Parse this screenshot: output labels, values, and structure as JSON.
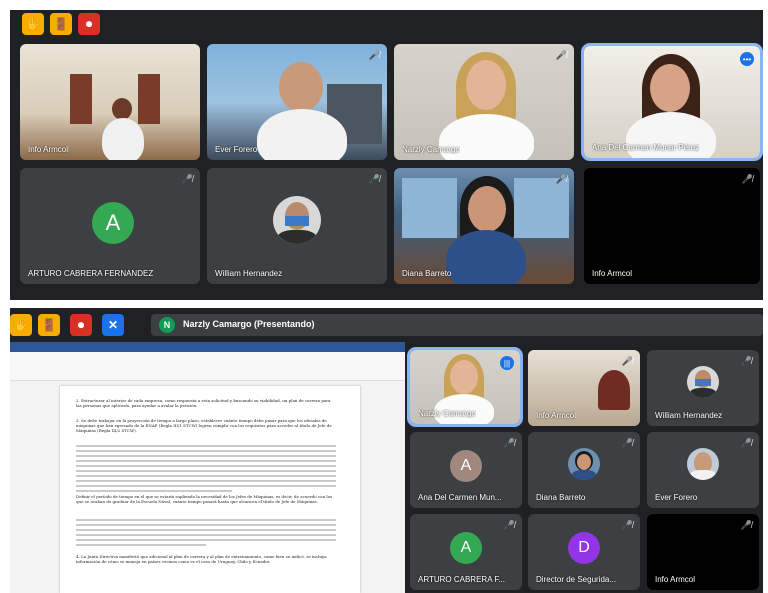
{
  "meeting1": {
    "tiles": [
      {
        "name": "Info Armcol"
      },
      {
        "name": "Ever Forero"
      },
      {
        "name": "Narzly Camargo"
      },
      {
        "name": "Ana Del Carmen Munar Pérez"
      },
      {
        "name": "ARTURO CABRERA FERNANDEZ",
        "initial": "A"
      },
      {
        "name": "William Hernandez"
      },
      {
        "name": "Diana Barreto"
      },
      {
        "name": "Info Armcol"
      }
    ]
  },
  "meeting2": {
    "presenter_initial": "N",
    "presenting_label": "Narzly Camargo (Presentando)",
    "tiles": [
      {
        "name": "Narzly Camargo"
      },
      {
        "name": "Info Armcol"
      },
      {
        "name": "William Hernandez"
      },
      {
        "name": "Ana Del Carmen Mun...",
        "initial": "A"
      },
      {
        "name": "Diana Barreto"
      },
      {
        "name": "Ever Forero"
      },
      {
        "name": "ARTURO CABRERA F...",
        "initial": "A"
      },
      {
        "name": "Director de Segurida...",
        "initial": "D"
      },
      {
        "name": "Info Armcol"
      }
    ]
  },
  "document": {
    "p1": "2.   Estructurar al interior de cada empresa, como respuesta a esta solicitud y buscando su viabilidad, un plan de carrera para las personas que aplicaría, para ayudar a avalar la petición.",
    "p2": "3.   Se debe trabajar en la proyección de tiempo a largo plazo, establecer cuánto tiempo debe pasar para que los oficiales de máquinas que han egresado de la ENAP (Regla III/1 STCW) logren cumplir con los requisitos para acceder al título de Jefe de Máquinas (Regla III/2 STCW).",
    "p3": "Definir el período de tiempo en el que se estaría supliendo la necesidad de los Jefes de Máquinas, es decir, de acuerdo con los que se acaban de graduar de la Escuela Naval, cuánto tiempo pasará hasta que alcancen el título de Jefe de Máquinas.",
    "p4": "4.   La Junta Directiva manifestó que adicional al plan de carrera y al plan de entrenamiento, como bien se indicó, se incluya información de cómo se maneja en países vecinos como es el caso de Uruguay, Chile y Ecuador."
  },
  "colors": {
    "meet_bg": "#202124",
    "tile_bg": "#3c4043",
    "accent_blue": "#1a73e8",
    "green_avatar": "#188038",
    "purple_avatar": "#9334e6",
    "brown_avatar": "#a1887f",
    "yellow_button": "#f9ab00",
    "red_button": "#d93025"
  }
}
